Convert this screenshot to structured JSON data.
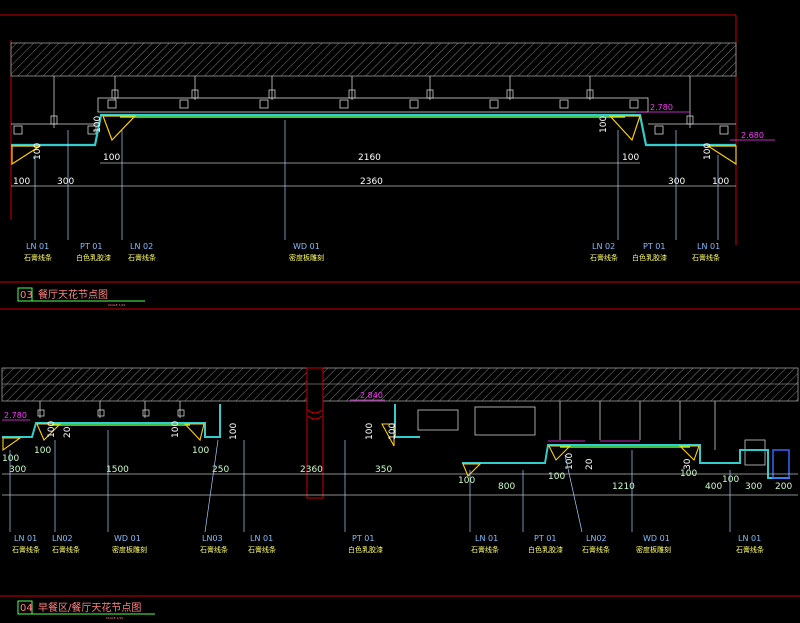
{
  "colors": {
    "background": "#000000",
    "border_red": "#cc0000",
    "ceiling_cyan": "#33cccc",
    "wood_green": "#55ff55",
    "plaster_yellow": "#ffcc00",
    "label_blue": "#7fbfff",
    "label_yellow": "#ffff66",
    "title_red": "#ff8080",
    "elevation_magenta": "#ff33ff"
  },
  "detail_03": {
    "number": "03",
    "title": "餐厅天花节点图",
    "scale": "SCALE 1/10",
    "elevations": [
      "2.780",
      "2.680"
    ],
    "section_labels": [
      "100",
      "100",
      "100",
      "100"
    ],
    "dims_row1": [
      "100",
      "2160",
      "100"
    ],
    "dims_row2": [
      "100",
      "300",
      "2360",
      "300",
      "100"
    ],
    "tags": [
      {
        "code": "LN 01",
        "desc": "石膏线条"
      },
      {
        "code": "PT 01",
        "desc": "白色乳胶漆"
      },
      {
        "code": "LN 02",
        "desc": "石膏线条"
      },
      {
        "code": "WD 01",
        "desc": "密度板雕刻"
      },
      {
        "code": "LN 02",
        "desc": "石膏线条"
      },
      {
        "code": "PT 01",
        "desc": "白色乳胶漆"
      },
      {
        "code": "LN 01",
        "desc": "石膏线条"
      }
    ]
  },
  "detail_04": {
    "number": "04",
    "title": "早餐区/餐厅天花节点图",
    "scale": "SCALE 1/10",
    "elevations": [
      "2.780",
      "2.840"
    ],
    "section_labels": [
      "100",
      "20",
      "100",
      "100",
      "100",
      "100",
      "100",
      "20",
      "30"
    ],
    "dims": [
      "100",
      "100",
      "300",
      "1500",
      "100",
      "250",
      "2360",
      "350",
      "100",
      "800",
      "100",
      "1210",
      "100",
      "400",
      "100",
      "300",
      "200"
    ],
    "tags": [
      {
        "code": "LN 01",
        "desc": "石膏线条"
      },
      {
        "code": "LN02",
        "desc": "石膏线条"
      },
      {
        "code": "WD 01",
        "desc": "密度板雕刻"
      },
      {
        "code": "LN03",
        "desc": "石膏线条"
      },
      {
        "code": "LN 01",
        "desc": "石膏线条"
      },
      {
        "code": "PT 01",
        "desc": "白色乳胶漆"
      },
      {
        "code": "LN 01",
        "desc": "石膏线条"
      },
      {
        "code": "PT 01",
        "desc": "白色乳胶漆"
      },
      {
        "code": "LN02",
        "desc": "石膏线条"
      },
      {
        "code": "WD 01",
        "desc": "密度板雕刻"
      },
      {
        "code": "LN 01",
        "desc": "石膏线条"
      }
    ]
  }
}
